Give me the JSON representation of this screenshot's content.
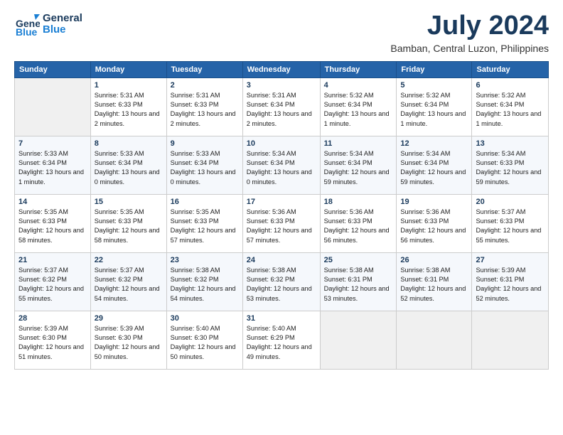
{
  "logo": {
    "line1": "General",
    "line2": "Blue"
  },
  "header": {
    "month_year": "July 2024",
    "location": "Bamban, Central Luzon, Philippines"
  },
  "weekdays": [
    "Sunday",
    "Monday",
    "Tuesday",
    "Wednesday",
    "Thursday",
    "Friday",
    "Saturday"
  ],
  "weeks": [
    [
      {
        "day": "",
        "sunrise": "",
        "sunset": "",
        "daylight": ""
      },
      {
        "day": "1",
        "sunrise": "Sunrise: 5:31 AM",
        "sunset": "Sunset: 6:33 PM",
        "daylight": "Daylight: 13 hours and 2 minutes."
      },
      {
        "day": "2",
        "sunrise": "Sunrise: 5:31 AM",
        "sunset": "Sunset: 6:33 PM",
        "daylight": "Daylight: 13 hours and 2 minutes."
      },
      {
        "day": "3",
        "sunrise": "Sunrise: 5:31 AM",
        "sunset": "Sunset: 6:34 PM",
        "daylight": "Daylight: 13 hours and 2 minutes."
      },
      {
        "day": "4",
        "sunrise": "Sunrise: 5:32 AM",
        "sunset": "Sunset: 6:34 PM",
        "daylight": "Daylight: 13 hours and 1 minute."
      },
      {
        "day": "5",
        "sunrise": "Sunrise: 5:32 AM",
        "sunset": "Sunset: 6:34 PM",
        "daylight": "Daylight: 13 hours and 1 minute."
      },
      {
        "day": "6",
        "sunrise": "Sunrise: 5:32 AM",
        "sunset": "Sunset: 6:34 PM",
        "daylight": "Daylight: 13 hours and 1 minute."
      }
    ],
    [
      {
        "day": "7",
        "sunrise": "Sunrise: 5:33 AM",
        "sunset": "Sunset: 6:34 PM",
        "daylight": "Daylight: 13 hours and 1 minute."
      },
      {
        "day": "8",
        "sunrise": "Sunrise: 5:33 AM",
        "sunset": "Sunset: 6:34 PM",
        "daylight": "Daylight: 13 hours and 0 minutes."
      },
      {
        "day": "9",
        "sunrise": "Sunrise: 5:33 AM",
        "sunset": "Sunset: 6:34 PM",
        "daylight": "Daylight: 13 hours and 0 minutes."
      },
      {
        "day": "10",
        "sunrise": "Sunrise: 5:34 AM",
        "sunset": "Sunset: 6:34 PM",
        "daylight": "Daylight: 13 hours and 0 minutes."
      },
      {
        "day": "11",
        "sunrise": "Sunrise: 5:34 AM",
        "sunset": "Sunset: 6:34 PM",
        "daylight": "Daylight: 12 hours and 59 minutes."
      },
      {
        "day": "12",
        "sunrise": "Sunrise: 5:34 AM",
        "sunset": "Sunset: 6:34 PM",
        "daylight": "Daylight: 12 hours and 59 minutes."
      },
      {
        "day": "13",
        "sunrise": "Sunrise: 5:34 AM",
        "sunset": "Sunset: 6:33 PM",
        "daylight": "Daylight: 12 hours and 59 minutes."
      }
    ],
    [
      {
        "day": "14",
        "sunrise": "Sunrise: 5:35 AM",
        "sunset": "Sunset: 6:33 PM",
        "daylight": "Daylight: 12 hours and 58 minutes."
      },
      {
        "day": "15",
        "sunrise": "Sunrise: 5:35 AM",
        "sunset": "Sunset: 6:33 PM",
        "daylight": "Daylight: 12 hours and 58 minutes."
      },
      {
        "day": "16",
        "sunrise": "Sunrise: 5:35 AM",
        "sunset": "Sunset: 6:33 PM",
        "daylight": "Daylight: 12 hours and 57 minutes."
      },
      {
        "day": "17",
        "sunrise": "Sunrise: 5:36 AM",
        "sunset": "Sunset: 6:33 PM",
        "daylight": "Daylight: 12 hours and 57 minutes."
      },
      {
        "day": "18",
        "sunrise": "Sunrise: 5:36 AM",
        "sunset": "Sunset: 6:33 PM",
        "daylight": "Daylight: 12 hours and 56 minutes."
      },
      {
        "day": "19",
        "sunrise": "Sunrise: 5:36 AM",
        "sunset": "Sunset: 6:33 PM",
        "daylight": "Daylight: 12 hours and 56 minutes."
      },
      {
        "day": "20",
        "sunrise": "Sunrise: 5:37 AM",
        "sunset": "Sunset: 6:33 PM",
        "daylight": "Daylight: 12 hours and 55 minutes."
      }
    ],
    [
      {
        "day": "21",
        "sunrise": "Sunrise: 5:37 AM",
        "sunset": "Sunset: 6:32 PM",
        "daylight": "Daylight: 12 hours and 55 minutes."
      },
      {
        "day": "22",
        "sunrise": "Sunrise: 5:37 AM",
        "sunset": "Sunset: 6:32 PM",
        "daylight": "Daylight: 12 hours and 54 minutes."
      },
      {
        "day": "23",
        "sunrise": "Sunrise: 5:38 AM",
        "sunset": "Sunset: 6:32 PM",
        "daylight": "Daylight: 12 hours and 54 minutes."
      },
      {
        "day": "24",
        "sunrise": "Sunrise: 5:38 AM",
        "sunset": "Sunset: 6:32 PM",
        "daylight": "Daylight: 12 hours and 53 minutes."
      },
      {
        "day": "25",
        "sunrise": "Sunrise: 5:38 AM",
        "sunset": "Sunset: 6:31 PM",
        "daylight": "Daylight: 12 hours and 53 minutes."
      },
      {
        "day": "26",
        "sunrise": "Sunrise: 5:38 AM",
        "sunset": "Sunset: 6:31 PM",
        "daylight": "Daylight: 12 hours and 52 minutes."
      },
      {
        "day": "27",
        "sunrise": "Sunrise: 5:39 AM",
        "sunset": "Sunset: 6:31 PM",
        "daylight": "Daylight: 12 hours and 52 minutes."
      }
    ],
    [
      {
        "day": "28",
        "sunrise": "Sunrise: 5:39 AM",
        "sunset": "Sunset: 6:30 PM",
        "daylight": "Daylight: 12 hours and 51 minutes."
      },
      {
        "day": "29",
        "sunrise": "Sunrise: 5:39 AM",
        "sunset": "Sunset: 6:30 PM",
        "daylight": "Daylight: 12 hours and 50 minutes."
      },
      {
        "day": "30",
        "sunrise": "Sunrise: 5:40 AM",
        "sunset": "Sunset: 6:30 PM",
        "daylight": "Daylight: 12 hours and 50 minutes."
      },
      {
        "day": "31",
        "sunrise": "Sunrise: 5:40 AM",
        "sunset": "Sunset: 6:29 PM",
        "daylight": "Daylight: 12 hours and 49 minutes."
      },
      {
        "day": "",
        "sunrise": "",
        "sunset": "",
        "daylight": ""
      },
      {
        "day": "",
        "sunrise": "",
        "sunset": "",
        "daylight": ""
      },
      {
        "day": "",
        "sunrise": "",
        "sunset": "",
        "daylight": ""
      }
    ]
  ]
}
